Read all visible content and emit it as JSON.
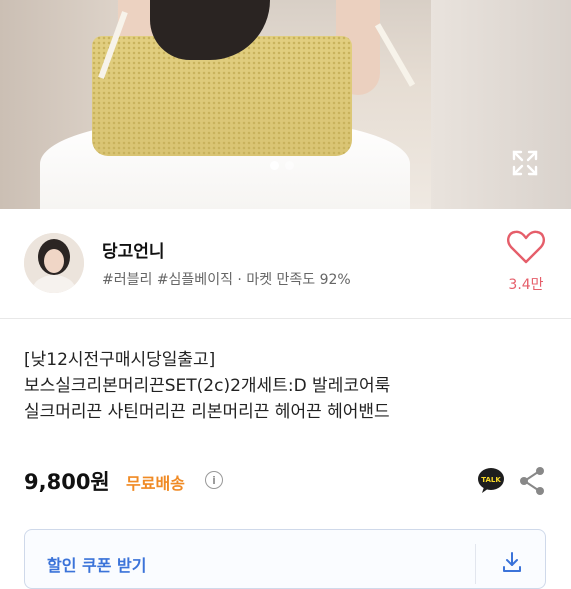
{
  "gallery": {
    "dots": [
      {
        "active": true
      },
      {
        "active": false
      }
    ],
    "expand_icon": "expand-arrows-icon"
  },
  "seller": {
    "name": "당고언니",
    "tags": "#러블리 #심플베이직",
    "separator": "·",
    "satisfaction": "마켓 만족도 92%",
    "likes": "3.4만",
    "like_icon": "heart-outline-icon"
  },
  "product": {
    "title_lines": [
      "[낮12시전구매시당일출고]",
      "보스실크리본머리끈SET(2c)2개세트:D  발레코어룩",
      "실크머리끈 사틴머리끈 리본머리끈 헤어끈 헤어밴드"
    ],
    "price": "9,800원",
    "shipping": "무료배송",
    "info_icon": "ⓘ"
  },
  "actions": {
    "talk_label": "TALK",
    "share_icon": "share-icon"
  },
  "coupon": {
    "label": "할인 쿠폰 받기",
    "icon": "download-icon"
  },
  "colors": {
    "accent_pink": "#e55e6a",
    "shipping_orange": "#f08a24",
    "coupon_blue": "#3b73d9",
    "kakao_yellow": "#f7d928"
  }
}
